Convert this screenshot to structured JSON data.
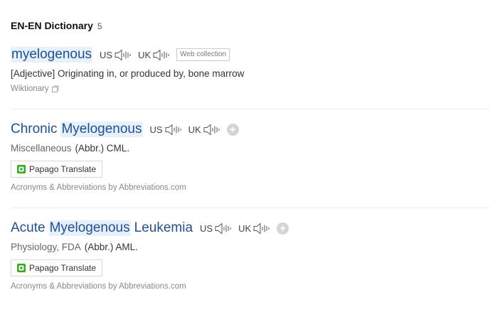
{
  "header": {
    "title": "EN-EN Dictionary",
    "count": "5"
  },
  "entries": [
    {
      "words": [
        {
          "text": "myelogenous",
          "hl": true
        }
      ],
      "pron": [
        {
          "label": "US"
        },
        {
          "label": "UK"
        }
      ],
      "badge": "Web collection",
      "definition": "[Adjective] Originating in, or produced by, bone marrow",
      "source": "Wiktionary"
    },
    {
      "words": [
        {
          "text": "Chronic",
          "hl": false
        },
        {
          "text": "Myelogenous",
          "hl": true
        }
      ],
      "pron": [
        {
          "label": "US"
        },
        {
          "label": "UK"
        }
      ],
      "category": "Miscellaneous",
      "definition": "(Abbr.) CML.",
      "translate_label": "Papago Translate",
      "source": "Acronyms & Abbreviations by Abbreviations.com"
    },
    {
      "words": [
        {
          "text": "Acute",
          "hl": false
        },
        {
          "text": "Myelogenous",
          "hl": true
        },
        {
          "text": "Leukemia",
          "hl": false
        }
      ],
      "pron": [
        {
          "label": "US"
        },
        {
          "label": "UK"
        }
      ],
      "category": "Physiology, FDA",
      "definition": "(Abbr.) AML.",
      "translate_label": "Papago Translate",
      "source": "Acronyms & Abbreviations by Abbreviations.com"
    }
  ],
  "icons": {
    "speaker": "speaker-icon",
    "plus": "add-to-wordbook-icon",
    "papago": "papago-logo-icon",
    "external": "external-link-icon"
  },
  "colors": {
    "headword": "#1f4e9c",
    "highlight": "#e6f1fb",
    "muted": "#888888"
  }
}
